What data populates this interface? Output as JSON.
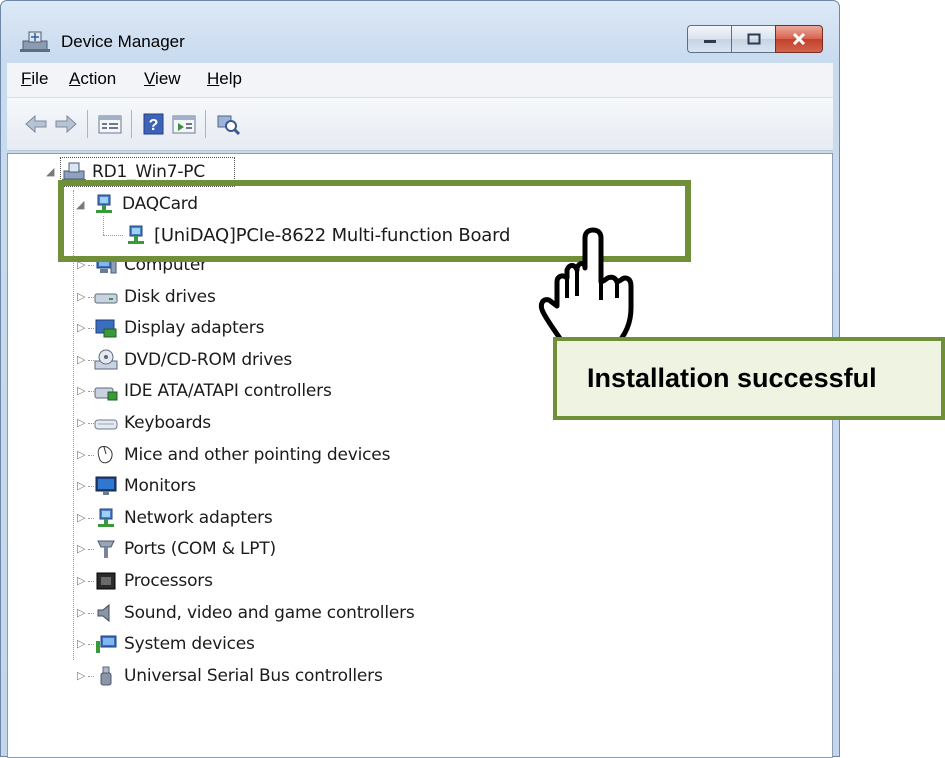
{
  "window": {
    "title": "Device Manager",
    "buttons": [
      "minimize",
      "maximize",
      "close"
    ]
  },
  "menu": [
    {
      "label": "File",
      "key": "F",
      "rest": "ile"
    },
    {
      "label": "Action",
      "key": "A",
      "rest": "ction"
    },
    {
      "label": "View",
      "key": "V",
      "rest": "iew"
    },
    {
      "label": "Help",
      "key": "H",
      "rest": "elp"
    }
  ],
  "toolbar": [
    "back-icon",
    "forward-icon",
    "properties-icon",
    "help-icon",
    "details-icon",
    "scan-hardware-icon"
  ],
  "tree": {
    "root": "RD1_Win7-PC",
    "daq_group": "DAQCard",
    "daq_device": "[UniDAQ]PCIe-8622 Multi-function Board",
    "categories": [
      {
        "label": "Computer",
        "icon": "computer-icon"
      },
      {
        "label": "Disk drives",
        "icon": "disk-drive-icon"
      },
      {
        "label": "Display adapters",
        "icon": "display-adapter-icon"
      },
      {
        "label": "DVD/CD-ROM drives",
        "icon": "dvd-drive-icon"
      },
      {
        "label": "IDE ATA/ATAPI controllers",
        "icon": "ide-controller-icon"
      },
      {
        "label": "Keyboards",
        "icon": "keyboard-icon"
      },
      {
        "label": "Mice and other pointing devices",
        "icon": "mouse-icon"
      },
      {
        "label": "Monitors",
        "icon": "monitor-icon"
      },
      {
        "label": "Network adapters",
        "icon": "network-adapter-icon"
      },
      {
        "label": "Ports (COM & LPT)",
        "icon": "port-icon"
      },
      {
        "label": "Processors",
        "icon": "processor-icon"
      },
      {
        "label": "Sound, video and game controllers",
        "icon": "sound-icon"
      },
      {
        "label": "System devices",
        "icon": "system-devices-icon"
      },
      {
        "label": "Universal Serial Bus controllers",
        "icon": "usb-icon"
      }
    ]
  },
  "annotation": {
    "callout_text": "Installation successful",
    "highlight_color": "#6f8f38",
    "callout_bg": "#eef3e2"
  }
}
